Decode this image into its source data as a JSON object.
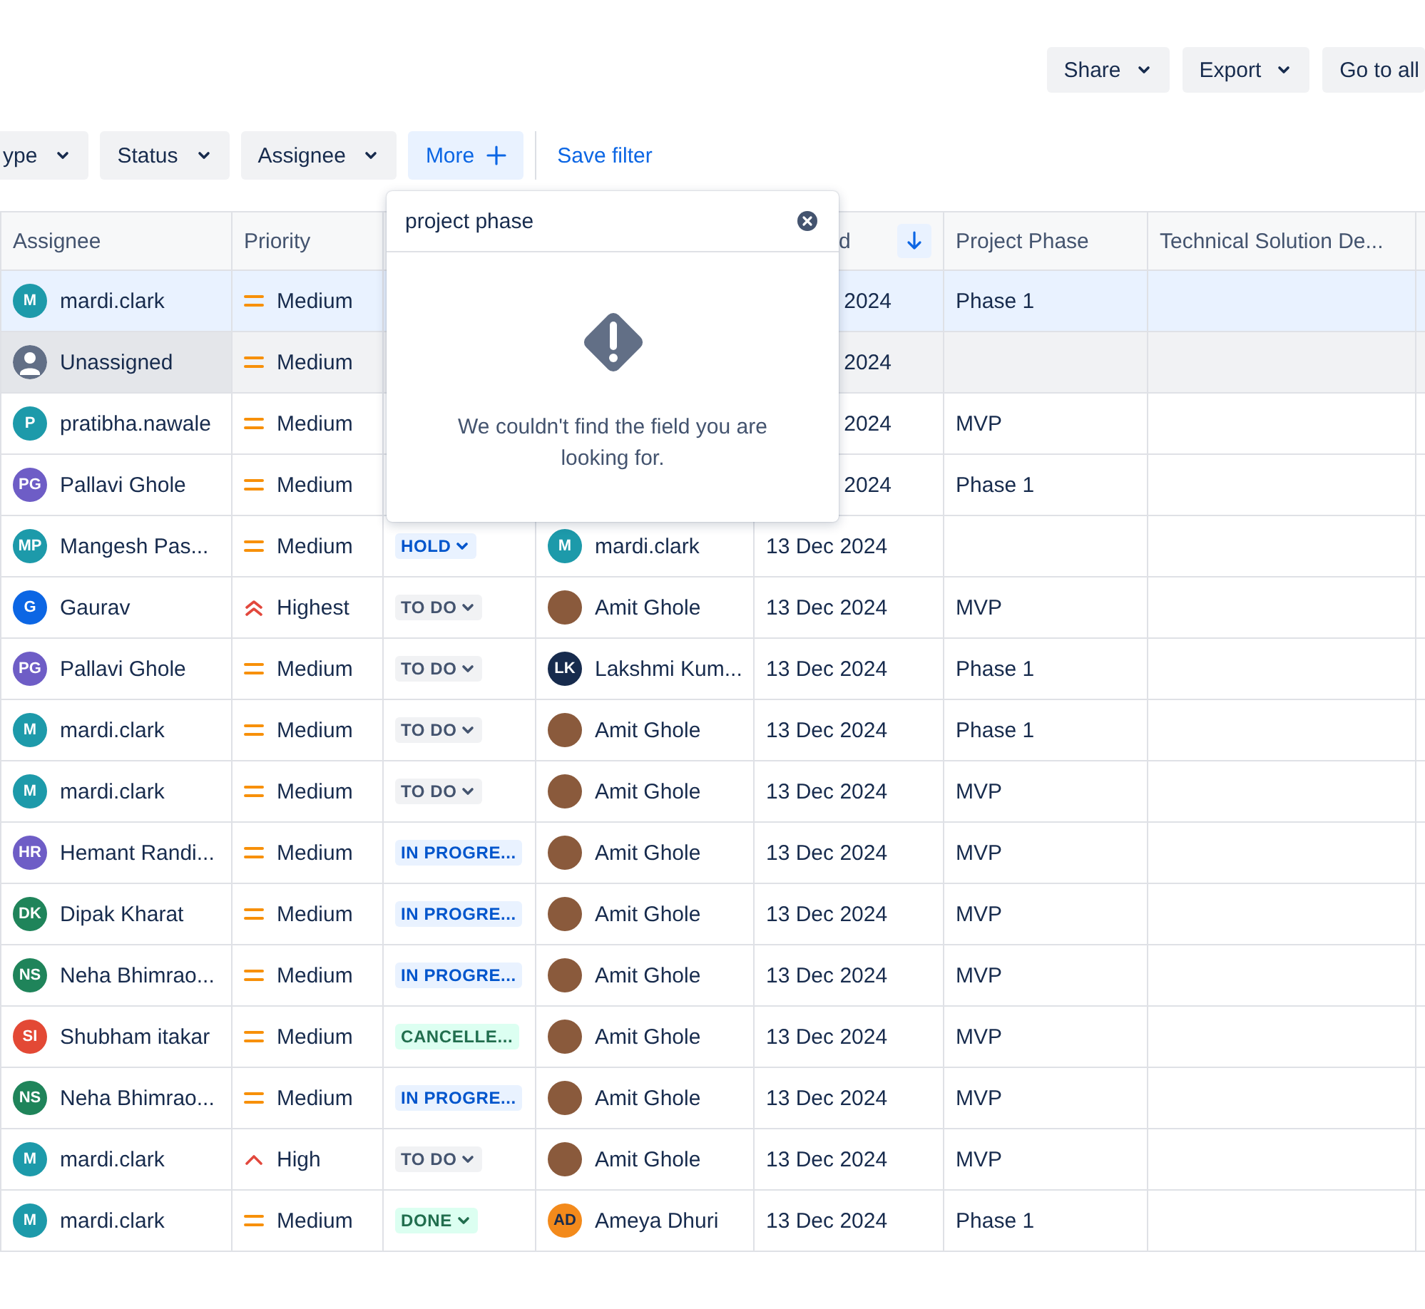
{
  "top_actions": [
    {
      "label": "Share",
      "kind": "menu"
    },
    {
      "label": "Export",
      "kind": "menu"
    },
    {
      "label": "Go to all",
      "kind": "plain"
    }
  ],
  "filters": [
    {
      "label": "ype",
      "kind": "menu",
      "selected": false
    },
    {
      "label": "Status",
      "kind": "menu",
      "selected": false
    },
    {
      "label": "Assignee",
      "kind": "menu",
      "selected": false
    },
    {
      "label": "More",
      "kind": "add",
      "selected": true
    }
  ],
  "save_filter": "Save filter",
  "table": {
    "columns": [
      {
        "label": "Assignee",
        "sorted": false
      },
      {
        "label": "Priority",
        "sorted": false
      },
      {
        "label": "d",
        "sorted": true
      },
      {
        "label": "Project Phase",
        "sorted": false
      },
      {
        "label": "Technical Solution De...",
        "sorted": false
      }
    ],
    "rows": [
      {
        "selected": true,
        "hovered": false,
        "assignee": {
          "kind": "initials",
          "initials": "M",
          "name": "mardi.clark",
          "color": "#1d9aaa"
        },
        "priority": {
          "label": "Medium",
          "kind": "medium"
        },
        "date": "2024",
        "phase": "Phase 1"
      },
      {
        "selected": false,
        "hovered": true,
        "assignee": {
          "kind": "unassigned",
          "name": "Unassigned"
        },
        "priority": {
          "label": "Medium",
          "kind": "medium"
        },
        "date": "2024"
      },
      {
        "selected": false,
        "hovered": false,
        "assignee": {
          "kind": "initials",
          "initials": "P",
          "name": "pratibha.nawale",
          "color": "#1d9aaa"
        },
        "priority": {
          "label": "Medium",
          "kind": "medium"
        },
        "date": "2024",
        "phase": "MVP"
      },
      {
        "selected": false,
        "hovered": false,
        "assignee": {
          "kind": "initials",
          "initials": "PG",
          "name": "Pallavi Ghole",
          "color": "#6e5dc6"
        },
        "priority": {
          "label": "Medium",
          "kind": "medium"
        },
        "date": "2024",
        "phase": "Phase 1"
      },
      {
        "selected": false,
        "hovered": false,
        "assignee": {
          "kind": "initials",
          "initials": "MP",
          "name": "Mangesh Pas...",
          "color": "#1d9aaa"
        },
        "priority": {
          "label": "Medium",
          "kind": "medium"
        },
        "status": {
          "label": "HOLD",
          "kind": "blue",
          "menu": true
        },
        "reporter": {
          "kind": "initials",
          "initials": "M",
          "name": "mardi.clark",
          "color": "#1d9aaa"
        },
        "date": "13 Dec 2024"
      },
      {
        "selected": false,
        "hovered": false,
        "assignee": {
          "kind": "initials",
          "initials": "G",
          "name": "Gaurav",
          "color": "#0c66e4"
        },
        "priority": {
          "label": "Highest",
          "kind": "highest"
        },
        "status": {
          "label": "TO DO",
          "kind": "grey",
          "menu": true
        },
        "reporter": {
          "kind": "photo",
          "name": "Amit Ghole"
        },
        "date": "13 Dec 2024",
        "phase": "MVP"
      },
      {
        "selected": false,
        "hovered": false,
        "assignee": {
          "kind": "initials",
          "initials": "PG",
          "name": "Pallavi Ghole",
          "color": "#6e5dc6"
        },
        "priority": {
          "label": "Medium",
          "kind": "medium"
        },
        "status": {
          "label": "TO DO",
          "kind": "grey",
          "menu": true
        },
        "reporter": {
          "kind": "initials",
          "initials": "LK",
          "name": "Lakshmi Kum...",
          "color": "#172b4d"
        },
        "date": "13 Dec 2024",
        "phase": "Phase 1"
      },
      {
        "selected": false,
        "hovered": false,
        "assignee": {
          "kind": "initials",
          "initials": "M",
          "name": "mardi.clark",
          "color": "#1d9aaa"
        },
        "priority": {
          "label": "Medium",
          "kind": "medium"
        },
        "status": {
          "label": "TO DO",
          "kind": "grey",
          "menu": true
        },
        "reporter": {
          "kind": "photo",
          "name": "Amit Ghole"
        },
        "date": "13 Dec 2024",
        "phase": "Phase 1"
      },
      {
        "selected": false,
        "hovered": false,
        "assignee": {
          "kind": "initials",
          "initials": "M",
          "name": "mardi.clark",
          "color": "#1d9aaa"
        },
        "priority": {
          "label": "Medium",
          "kind": "medium"
        },
        "status": {
          "label": "TO DO",
          "kind": "grey",
          "menu": true
        },
        "reporter": {
          "kind": "photo",
          "name": "Amit Ghole"
        },
        "date": "13 Dec 2024",
        "phase": "MVP"
      },
      {
        "selected": false,
        "hovered": false,
        "assignee": {
          "kind": "initials",
          "initials": "HR",
          "name": "Hemant Randi...",
          "color": "#6e5dc6"
        },
        "priority": {
          "label": "Medium",
          "kind": "medium"
        },
        "status": {
          "label": "IN PROGRE...",
          "kind": "blue",
          "menu": false
        },
        "reporter": {
          "kind": "photo",
          "name": "Amit Ghole"
        },
        "date": "13 Dec 2024",
        "phase": "MVP"
      },
      {
        "selected": false,
        "hovered": false,
        "assignee": {
          "kind": "initials",
          "initials": "DK",
          "name": "Dipak Kharat",
          "color": "#1f845a"
        },
        "priority": {
          "label": "Medium",
          "kind": "medium"
        },
        "status": {
          "label": "IN PROGRE...",
          "kind": "blue",
          "menu": false
        },
        "reporter": {
          "kind": "photo",
          "name": "Amit Ghole"
        },
        "date": "13 Dec 2024",
        "phase": "MVP"
      },
      {
        "selected": false,
        "hovered": false,
        "assignee": {
          "kind": "initials",
          "initials": "NS",
          "name": "Neha Bhimrao...",
          "color": "#1f845a"
        },
        "priority": {
          "label": "Medium",
          "kind": "medium"
        },
        "status": {
          "label": "IN PROGRE...",
          "kind": "blue",
          "menu": false
        },
        "reporter": {
          "kind": "photo",
          "name": "Amit Ghole"
        },
        "date": "13 Dec 2024",
        "phase": "MVP"
      },
      {
        "selected": false,
        "hovered": false,
        "assignee": {
          "kind": "initials",
          "initials": "SI",
          "name": "Shubham itakar",
          "color": "#e34935"
        },
        "priority": {
          "label": "Medium",
          "kind": "medium"
        },
        "status": {
          "label": "CANCELLE...",
          "kind": "green",
          "menu": false
        },
        "reporter": {
          "kind": "photo",
          "name": "Amit Ghole"
        },
        "date": "13 Dec 2024",
        "phase": "MVP"
      },
      {
        "selected": false,
        "hovered": false,
        "assignee": {
          "kind": "initials",
          "initials": "NS",
          "name": "Neha Bhimrao...",
          "color": "#1f845a"
        },
        "priority": {
          "label": "Medium",
          "kind": "medium"
        },
        "status": {
          "label": "IN PROGRE...",
          "kind": "blue",
          "menu": false
        },
        "reporter": {
          "kind": "photo",
          "name": "Amit Ghole"
        },
        "date": "13 Dec 2024",
        "phase": "MVP"
      },
      {
        "selected": false,
        "hovered": false,
        "assignee": {
          "kind": "initials",
          "initials": "M",
          "name": "mardi.clark",
          "color": "#1d9aaa"
        },
        "priority": {
          "label": "High",
          "kind": "high"
        },
        "status": {
          "label": "TO DO",
          "kind": "grey",
          "menu": true
        },
        "reporter": {
          "kind": "photo",
          "name": "Amit Ghole"
        },
        "date": "13 Dec 2024",
        "phase": "MVP"
      },
      {
        "selected": false,
        "hovered": false,
        "assignee": {
          "kind": "initials",
          "initials": "M",
          "name": "mardi.clark",
          "color": "#1d9aaa"
        },
        "priority": {
          "label": "Medium",
          "kind": "medium"
        },
        "status": {
          "label": "DONE",
          "kind": "green",
          "menu": true
        },
        "reporter": {
          "kind": "initials",
          "initials": "AD",
          "name": "Ameya Dhuri",
          "color": "#f38a1b"
        },
        "date": "13 Dec 2024",
        "phase": "Phase 1"
      }
    ]
  },
  "field_search": {
    "value": "project phase",
    "message": "We couldn't find the field you are looking for."
  }
}
